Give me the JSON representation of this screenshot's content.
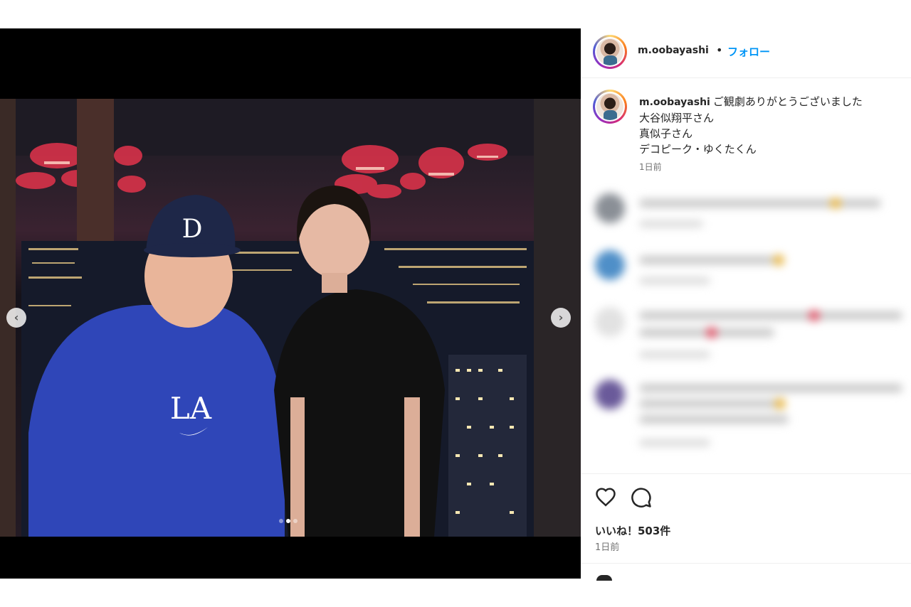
{
  "post": {
    "username": "m.oobayashi",
    "separator": "•",
    "follow_label": "フォロー",
    "caption_lines": [
      "ご観劇ありがとうございました",
      "大谷似翔平さん",
      "真似子さん",
      "デコピーク・ゆくたくん"
    ],
    "caption_time": "1日前",
    "likes": "いいね！503件",
    "date": "1日前"
  },
  "media": {
    "prev_icon": "chevron-left-icon",
    "next_icon": "chevron-right-icon",
    "prev_glyph": "‹",
    "next_glyph": "›",
    "carousel_dots": 3,
    "active_dot": 1,
    "cap_logo_text": "D",
    "shirt_logo_text": "LA"
  },
  "icons": {
    "like": "heart-icon",
    "comment": "comment-bubble-icon"
  },
  "colors": {
    "accent": "#0095f6",
    "text": "#262626",
    "muted": "#737373",
    "border": "#efefef"
  }
}
